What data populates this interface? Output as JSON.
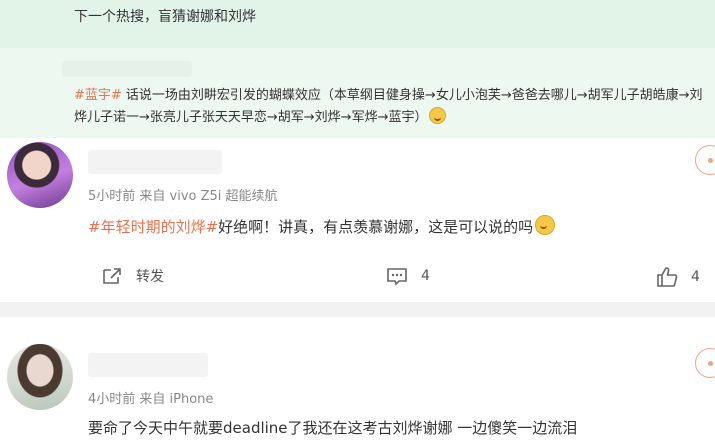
{
  "feed": {
    "top_post": {
      "text": "下一个热搜，盲猜谢娜和刘烨"
    },
    "repost": {
      "tag": "#蓝宇#",
      "text": " 话说一场由刘畊宏引发的蝴蝶效应（本草纲目健身操→女儿小泡芙→爸爸去哪儿→胡军儿子胡皓康→刘烨儿子诺一→张亮儿子张天天早恋→胡军→刘烨→军烨→蓝宇）",
      "emoji": "laughing-crying-emoji"
    },
    "posts": [
      {
        "meta": "5小时前  来自 vivo Z5i 超能续航",
        "tag": "#年轻时期的刘烨#",
        "text": "好绝啊！讲真，有点羡慕谢娜，这是可以说的吗",
        "emoji": "thinking-emoji",
        "repost_label": "转发",
        "comment_count": "4",
        "like_count": "4"
      },
      {
        "meta": "4小时前  来自 iPhone",
        "text": "要命了今天中午就要deadline了我还在这考古刘烨谢娜 一边傻笑一边流泪"
      }
    ]
  },
  "colors": {
    "tag": "#eb7350",
    "top_bg": "#e2f3e8",
    "repost_bg": "#edf8f1",
    "meta": "#888888"
  },
  "icons": [
    "repost-icon",
    "comment-icon",
    "like-icon",
    "follow-icon"
  ]
}
